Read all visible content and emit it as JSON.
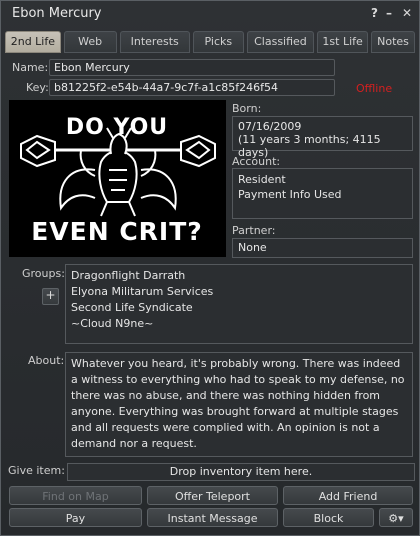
{
  "window": {
    "title": "Ebon Mercury",
    "help_icon": "?",
    "minimize_icon": "–",
    "close_icon": "✕"
  },
  "tabs": [
    {
      "label": "2nd Life",
      "active": true
    },
    {
      "label": "Web"
    },
    {
      "label": "Interests"
    },
    {
      "label": "Picks"
    },
    {
      "label": "Classified"
    },
    {
      "label": "1st Life"
    },
    {
      "label": "Notes"
    }
  ],
  "profile": {
    "name_label": "Name:",
    "name_value": "Ebon Mercury",
    "key_label": "Key:",
    "key_value": "b81225f2-e54b-44a7-9c7f-a1c85f246f54",
    "status": "Offline",
    "status_color": "#d42020",
    "image_text_top": "DO YOU",
    "image_text_bottom": "EVEN CRIT?",
    "born_label": "Born:",
    "born_date": "07/16/2009",
    "born_age": "(11 years 3 months; 4115 days)",
    "account_label": "Account:",
    "account_type": "Resident",
    "account_payment": "Payment Info Used",
    "partner_label": "Partner:",
    "partner_value": "None"
  },
  "groups": {
    "label": "Groups:",
    "add_button": "+",
    "items": [
      "Dragonflight Darrath",
      "Elyona Militarum Services",
      "Second Life Syndicate",
      "~Cloud N9ne~"
    ]
  },
  "about": {
    "label": "About:",
    "text": "Whatever you heard, it's probably wrong.  There was indeed a witness to everything who had to speak to my defense, no there was no abuse, and there was nothing hidden from anyone.  Everything was brought forward at multiple stages and all requests were complied with.  An opinion is not a demand nor a request."
  },
  "give_item": {
    "label": "Give item:",
    "drop_text": "Drop inventory item here."
  },
  "buttons": {
    "find_on_map": "Find on Map",
    "offer_teleport": "Offer Teleport",
    "add_friend": "Add Friend",
    "pay": "Pay",
    "instant_message": "Instant Message",
    "block": "Block",
    "gear_icon": "⚙▾"
  }
}
